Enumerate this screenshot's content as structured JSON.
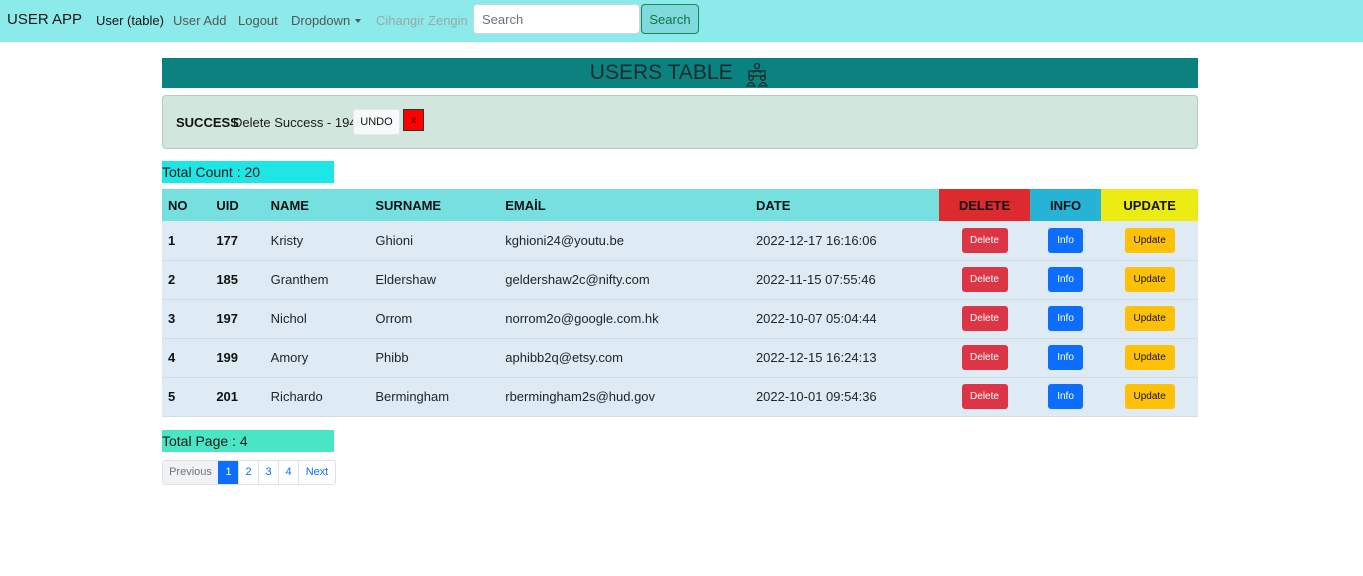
{
  "navbar": {
    "brand": "USER APP",
    "links": [
      {
        "label": "User (table)"
      },
      {
        "label": "User Add"
      },
      {
        "label": "Logout"
      },
      {
        "label": "Dropdown"
      },
      {
        "label": "Cihangir Zengin"
      }
    ],
    "search": {
      "placeholder": "Search",
      "value": "",
      "button_label": "Search"
    }
  },
  "title": {
    "text": "USERS TABLE",
    "icon": "users-group-icon"
  },
  "alert": {
    "strong": "SUCCESS",
    "message": "Delete Success - 194",
    "undo_label": "UNDO",
    "close_label": "x"
  },
  "total_count": "Total Count : 20",
  "table": {
    "headers": {
      "no": "NO",
      "uid": "UID",
      "name": "NAME",
      "surname": "SURNAME",
      "email": "EMAİL",
      "date": "DATE",
      "delete": "DELETE",
      "info": "INFO",
      "update": "UPDATE"
    },
    "action_labels": {
      "delete": "Delete",
      "info": "Info",
      "update": "Update"
    },
    "rows": [
      {
        "no": "1",
        "uid": "177",
        "name": "Kristy",
        "surname": "Ghioni",
        "email": "kghioni24@youtu.be",
        "date": "2022-12-17 16:16:06"
      },
      {
        "no": "2",
        "uid": "185",
        "name": "Granthem",
        "surname": "Eldershaw",
        "email": "geldershaw2c@nifty.com",
        "date": "2022-11-15 07:55:46"
      },
      {
        "no": "3",
        "uid": "197",
        "name": "Nichol",
        "surname": "Orrom",
        "email": "norrom2o@google.com.hk",
        "date": "2022-10-07 05:04:44"
      },
      {
        "no": "4",
        "uid": "199",
        "name": "Amory",
        "surname": "Phibb",
        "email": "aphibb2q@etsy.com",
        "date": "2022-12-15 16:24:13"
      },
      {
        "no": "5",
        "uid": "201",
        "name": "Richardo",
        "surname": "Bermingham",
        "email": "rbermingham2s@hud.gov",
        "date": "2022-10-01 09:54:36"
      }
    ]
  },
  "total_page": "Total Page : 4",
  "pagination": {
    "previous": "Previous",
    "pages": [
      "1",
      "2",
      "3",
      "4"
    ],
    "current": "1",
    "next": "Next"
  },
  "colors": {
    "navbar": "#8deaeb",
    "title_bar": "#0b8280",
    "alert_bg": "#d1e7dd",
    "count_box": "#1ee6e6",
    "page_box": "#49e5c5",
    "header": "#76e0e1",
    "delete_header": "#dc2a2f",
    "info_header": "#26b3d6",
    "update_header": "#ecec14",
    "row_bg": "#deebf4"
  }
}
